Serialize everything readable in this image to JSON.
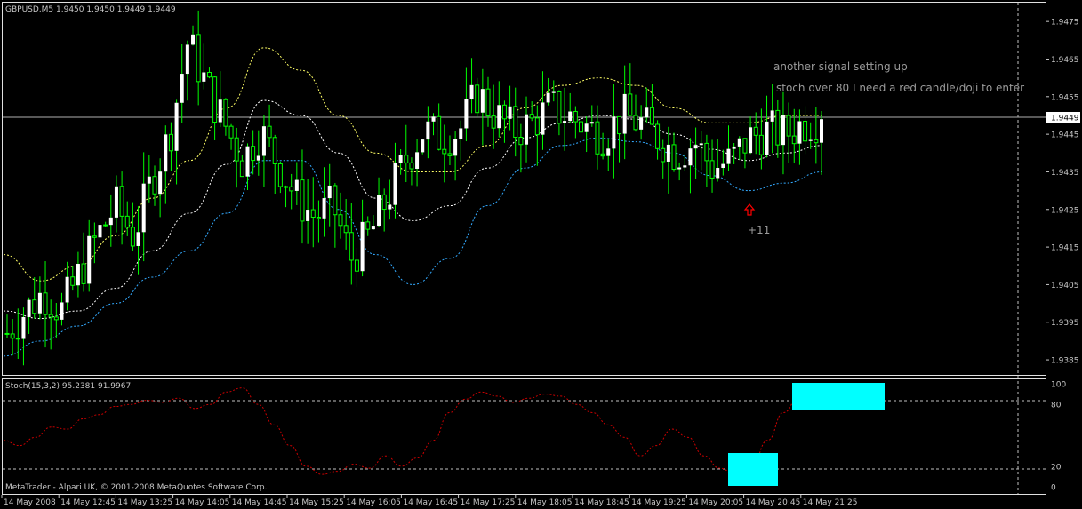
{
  "header": {
    "title": "GBPUSD,M5  1.9450 1.9450 1.9449 1.9449"
  },
  "footer": {
    "copyright": "MetaTrader - Alpari UK, © 2001-2008 MetaQuotes Software Corp."
  },
  "annotations": {
    "line1": "another signal setting up",
    "line2": "stoch over 80 I need a red candle/doji  to enter",
    "profit": "+11"
  },
  "colors": {
    "background": "#000000",
    "candle_up": "#ffffff",
    "candle_wick": "#00ff00",
    "envelope_upper": "#ffff66",
    "envelope_mid": "#ffffff",
    "envelope_lower": "#33aaff",
    "stoch_line": "#cc0000",
    "highlight_box": "#00ffff",
    "arrow": "#ff0000",
    "level_line": "#ffffff"
  },
  "chart_data": [
    {
      "type": "candlestick",
      "symbol": "GBPUSD",
      "timeframe": "M5",
      "current_price_label": "1.9449",
      "y_ticks": [
        "1.9475",
        "1.9465",
        "1.9455",
        "1.9445",
        "1.9435",
        "1.9425",
        "1.9415",
        "1.9405",
        "1.9395",
        "1.9385"
      ],
      "y_tick_values": [
        1.9475,
        1.9465,
        1.9455,
        1.9445,
        1.9435,
        1.9425,
        1.9415,
        1.9405,
        1.9395,
        1.9385
      ],
      "ylim": [
        1.9381,
        1.948
      ],
      "x_ticks": [
        "14 May 2008",
        "14 May 12:45",
        "14 May 13:25",
        "14 May 14:05",
        "14 May 14:45",
        "14 May 15:25",
        "14 May 16:05",
        "14 May 16:45",
        "14 May 17:25",
        "14 May 18:05",
        "14 May 18:45",
        "14 May 19:25",
        "14 May 20:05",
        "14 May 20:45",
        "14 May 21:25"
      ],
      "current_price": 1.9449,
      "close_path": [
        1.9392,
        1.9398,
        1.9403,
        1.9398,
        1.9408,
        1.9418,
        1.9426,
        1.9418,
        1.9433,
        1.9445,
        1.947,
        1.9458,
        1.9448,
        1.9438,
        1.9446,
        1.9437,
        1.9428,
        1.9423,
        1.9426,
        1.9412,
        1.9418,
        1.9428,
        1.9438,
        1.9446,
        1.9444,
        1.9446,
        1.9456,
        1.945,
        1.9446,
        1.9448,
        1.9452,
        1.945,
        1.9447,
        1.9445,
        1.945,
        1.9448,
        1.9444,
        1.944,
        1.9443,
        1.9436,
        1.9438,
        1.9444,
        1.9446,
        1.9445,
        1.9448,
        1.9449
      ],
      "envelope_upper_path": [
        1.9413,
        1.9406,
        1.941,
        1.9418,
        1.9428,
        1.9438,
        1.9452,
        1.9468,
        1.9462,
        1.945,
        1.944,
        1.9435,
        1.9435,
        1.9442,
        1.9452,
        1.9458,
        1.946,
        1.9458,
        1.9452,
        1.9448,
        1.9448,
        1.945,
        1.945
      ],
      "envelope_mid_path": [
        1.9398,
        1.9396,
        1.9398,
        1.9404,
        1.9414,
        1.9424,
        1.9437,
        1.9454,
        1.945,
        1.944,
        1.9428,
        1.9422,
        1.9426,
        1.9436,
        1.9444,
        1.9448,
        1.945,
        1.9449,
        1.9445,
        1.9441,
        1.9438,
        1.944,
        1.9442
      ],
      "envelope_lower_path": [
        1.9386,
        1.939,
        1.9394,
        1.94,
        1.9407,
        1.9414,
        1.9424,
        1.9438,
        1.9438,
        1.9425,
        1.9413,
        1.9405,
        1.9412,
        1.9426,
        1.9436,
        1.9442,
        1.9444,
        1.9443,
        1.944,
        1.9434,
        1.943,
        1.9432,
        1.9435
      ],
      "signal_arrow_at_index": 38
    },
    {
      "type": "line",
      "indicator": "Stoch(15,3,2) 95.2381 91.9967",
      "main": 95.2381,
      "signal": 91.9967,
      "y_ticks": [
        "100",
        "80",
        "20",
        "0"
      ],
      "y_tick_values": [
        100,
        80,
        20,
        0
      ],
      "levels": [
        80,
        20
      ],
      "ylim": [
        0,
        100
      ],
      "values": [
        45,
        40,
        48,
        58,
        56,
        66,
        70,
        78,
        80,
        84,
        82,
        86,
        76,
        80,
        92,
        96,
        80,
        60,
        40,
        20,
        12,
        15,
        22,
        18,
        30,
        20,
        28,
        45,
        72,
        85,
        92,
        88,
        82,
        86,
        90,
        88,
        80,
        72,
        60,
        48,
        30,
        40,
        56,
        48,
        30,
        18,
        12,
        20,
        45,
        72,
        88,
        95,
        92
      ]
    }
  ]
}
